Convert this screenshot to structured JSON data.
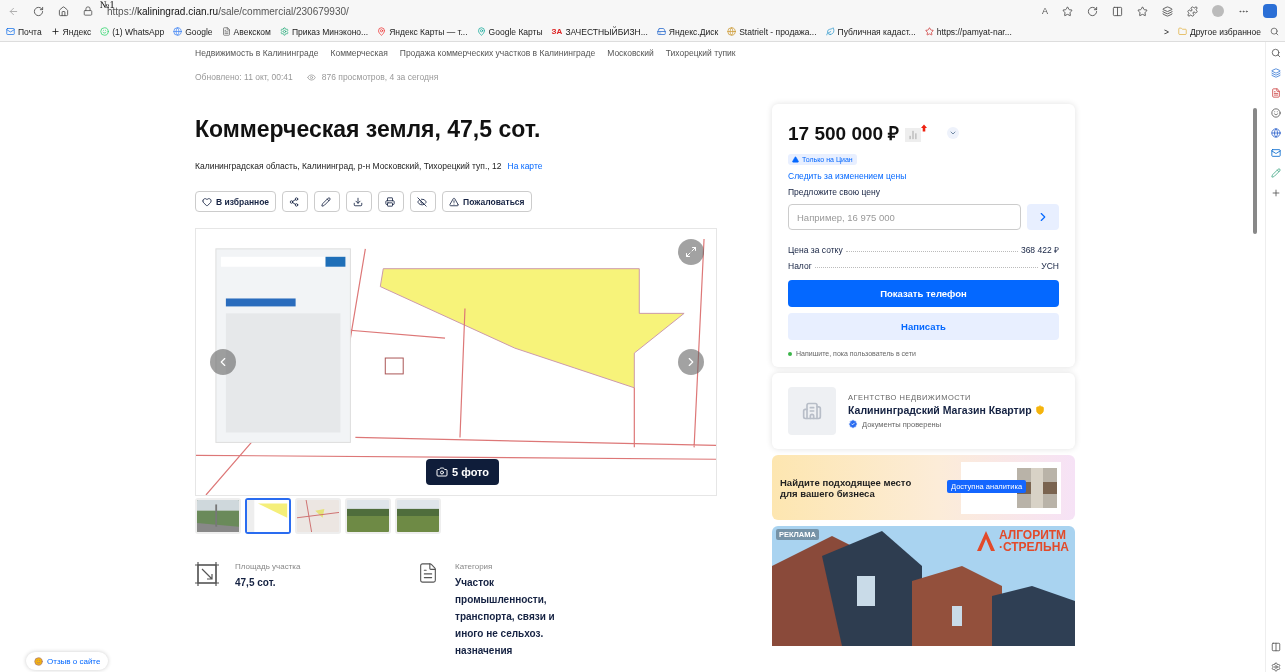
{
  "marker": "№1",
  "browser": {
    "url": "https://**kaliningrad.cian.ru**/sale/commercial/230679930/",
    "read_aloud": "A"
  },
  "bookmarks": [
    {
      "kind": "mail",
      "label": "Почта"
    },
    {
      "kind": "dark",
      "label": "Яндекс"
    },
    {
      "kind": "whatsapp",
      "label": "(1) WhatsApp"
    },
    {
      "kind": "google",
      "label": "Google"
    },
    {
      "kind": "doc",
      "label": "Авекском"
    },
    {
      "kind": "gear",
      "label": "Приказ Минэконо..."
    },
    {
      "kind": "pin",
      "label": "Яндекс Карты — т..."
    },
    {
      "kind": "pin2",
      "label": "Google Карты"
    },
    {
      "kind": "text",
      "badge": "ЗА",
      "label": "ЗАЧЕСТНЫЙБИЗН..."
    },
    {
      "kind": "disk",
      "label": "Яндекс.Диск"
    },
    {
      "kind": "globe",
      "label": "Statrielt - продажа..."
    },
    {
      "kind": "leaf",
      "label": "Публичная кадаст..."
    },
    {
      "kind": "star",
      "label": "https://pamyat-nar..."
    }
  ],
  "bookmarks_more": ">",
  "other_bookmarks": "Другое избранное",
  "breadcrumbs": [
    "Недвижимость в Калининграде",
    "Коммерческая",
    "Продажа коммерческих участков в Калининграде",
    "Московский",
    "Тихорецкий тупик"
  ],
  "meta": {
    "updated": "Обновлено: 11 окт, 00:41",
    "views": "876 просмотров, 4 за сегодня"
  },
  "title": "Коммерческая земля, 47,5 сот.",
  "address": "Калининградская область, Калининград, р-н Московский, Тихорецкий туп., 12",
  "map_link": "На карте",
  "actions": [
    {
      "kind": "favorite",
      "label": "В избранное"
    },
    {
      "kind": "share"
    },
    {
      "kind": "edit"
    },
    {
      "kind": "download"
    },
    {
      "kind": "print"
    },
    {
      "kind": "hide"
    },
    {
      "kind": "report",
      "label": "Пожаловаться"
    }
  ],
  "gallery": {
    "photo_count": "5 фото",
    "thumbnails": [
      {
        "kind": "road",
        "selected": false
      },
      {
        "kind": "plan",
        "selected": true
      },
      {
        "kind": "map",
        "selected": false
      },
      {
        "kind": "field",
        "selected": false
      },
      {
        "kind": "field",
        "selected": false
      }
    ]
  },
  "features": [
    {
      "kind": "area",
      "label": "Площадь участка",
      "value": "47,5 сот."
    },
    {
      "kind": "category",
      "label": "Категория",
      "value": "Участок промышленности, транспорта, связи и иного не сельхоз. назначения"
    }
  ],
  "price_card": {
    "price": "17 500 000 ₽",
    "badge": "Только на Циан",
    "watch_link": "Следить за изменением цены",
    "offer_label": "Предложите свою цену",
    "offer_placeholder": "Например, 16 975 000",
    "rows": [
      {
        "label": "Цена за сотку",
        "value": "368 422 ₽"
      },
      {
        "label": "Налог",
        "value": "УСН"
      }
    ],
    "phone_button": "Показать телефон",
    "write_button": "Написать",
    "status": "Напишите, пока пользователь в сети",
    "online": true
  },
  "agency": {
    "type": "АГЕНТСТВО НЕДВИЖИМОСТИ",
    "name": "Калининградский Магазин Квартир",
    "verified": "Документы проверены"
  },
  "promo": {
    "text": "Найдите подходящее место для вашего бизнеса",
    "chip": "Доступна аналитика"
  },
  "ad": {
    "label": "РЕКЛАМА",
    "brand_top": "АЛГОРИТМ",
    "brand_bottom": "·СТРЕЛЬНА"
  },
  "feedback": "Отзыв о сайте"
}
